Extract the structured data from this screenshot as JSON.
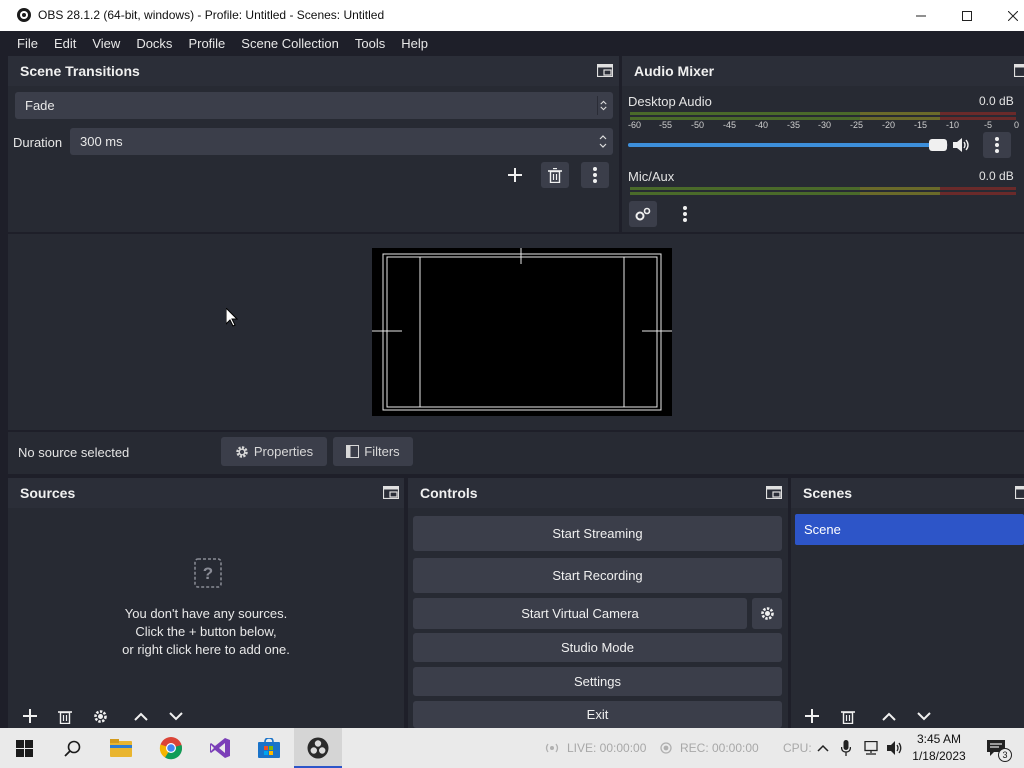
{
  "window": {
    "title": "OBS 28.1.2 (64-bit, windows) - Profile: Untitled - Scenes: Untitled"
  },
  "menu": {
    "items": [
      "File",
      "Edit",
      "View",
      "Docks",
      "Profile",
      "Scene Collection",
      "Tools",
      "Help"
    ]
  },
  "scene_transitions": {
    "title": "Scene Transitions",
    "transition": "Fade",
    "duration_label": "Duration",
    "duration_value": "300 ms"
  },
  "audio_mixer": {
    "title": "Audio Mixer",
    "ticks": [
      "-60",
      "-55",
      "-50",
      "-45",
      "-40",
      "-35",
      "-30",
      "-25",
      "-20",
      "-15",
      "-10",
      "-5",
      "0"
    ],
    "channels": [
      {
        "name": "Desktop Audio",
        "level": "0.0 dB",
        "volume_fraction": 0.97
      },
      {
        "name": "Mic/Aux",
        "level": "0.0 dB"
      }
    ]
  },
  "source_bar": {
    "status": "No source selected",
    "properties_label": "Properties",
    "filters_label": "Filters"
  },
  "sources": {
    "title": "Sources",
    "empty_line1": "You don't have any sources.",
    "empty_line2": "Click the + button below,",
    "empty_line3": "or right click here to add one."
  },
  "controls": {
    "title": "Controls",
    "start_streaming": "Start Streaming",
    "start_recording": "Start Recording",
    "start_virtual_camera": "Start Virtual Camera",
    "studio_mode": "Studio Mode",
    "settings": "Settings",
    "exit": "Exit"
  },
  "scenes": {
    "title": "Scenes",
    "items": [
      "Scene"
    ]
  },
  "status": {
    "live": "LIVE: 00:00:00",
    "rec": "REC: 00:00:00",
    "cpu": "CPU:"
  },
  "taskbar": {
    "time": "3:45 AM",
    "date": "1/18/2023",
    "notification_count": "3"
  },
  "colors": {
    "accent": "#2d55c8",
    "dock_bg": "#272a33",
    "button_bg": "#3b3e4a"
  }
}
